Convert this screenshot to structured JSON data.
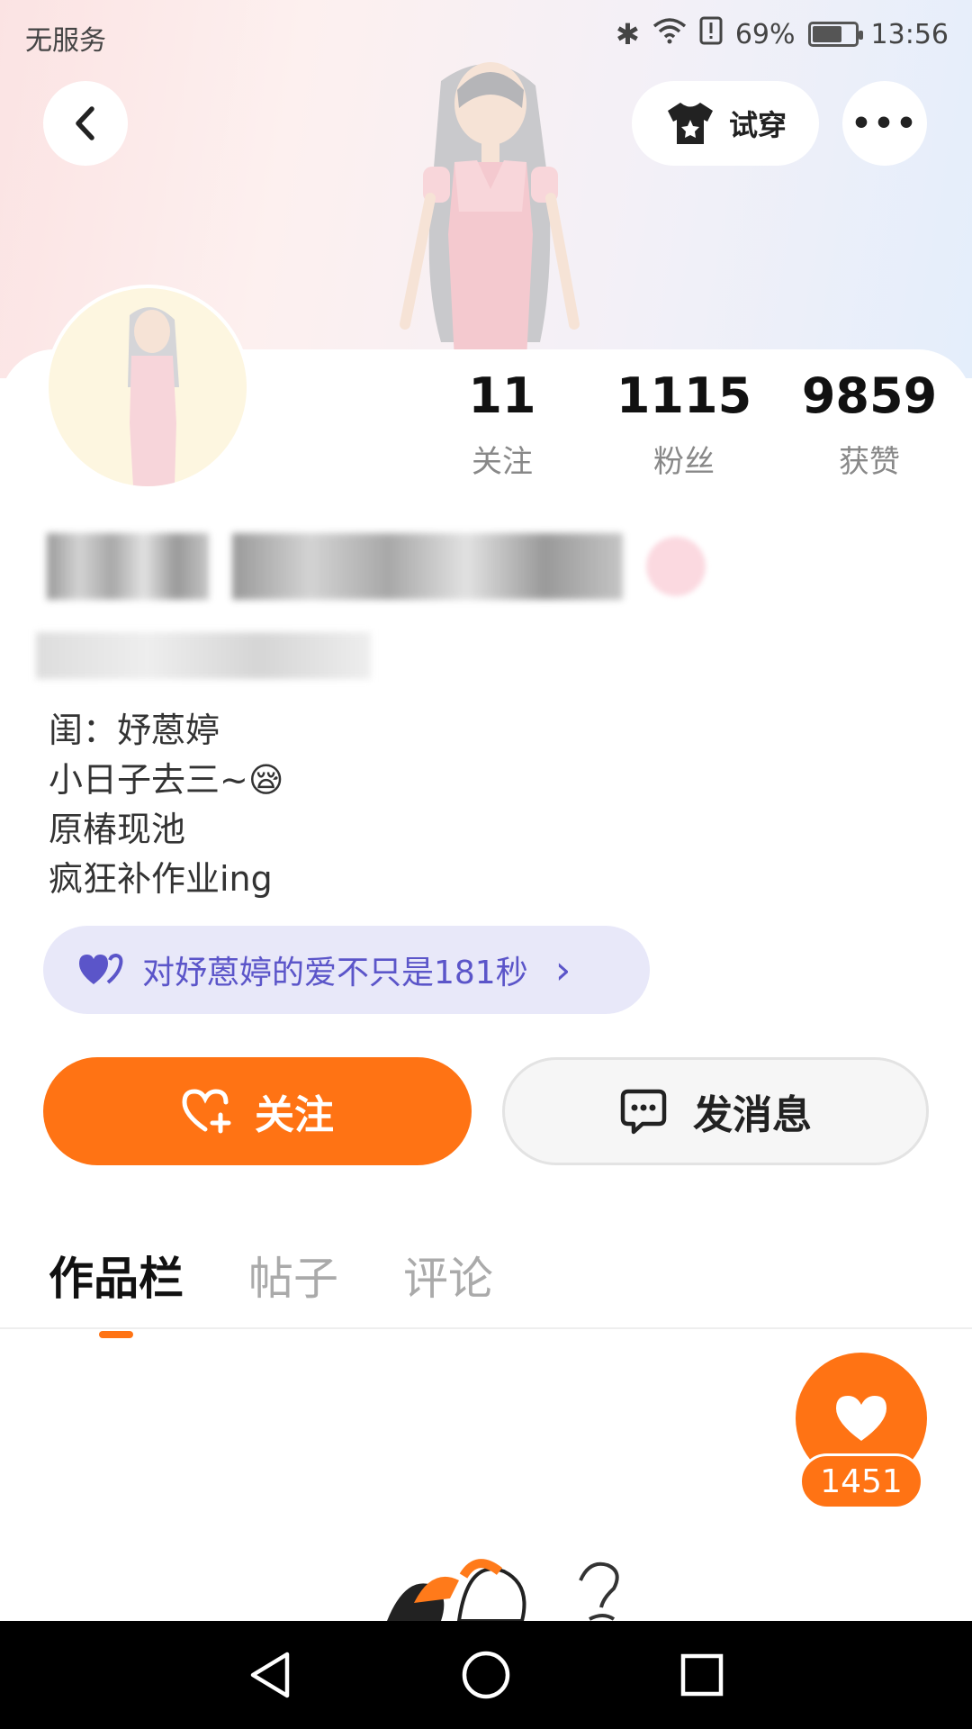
{
  "status_bar": {
    "carrier": "无服务",
    "battery_percent": "69%",
    "time": "13:56",
    "battery_level": 0.69
  },
  "header": {
    "tryon_label": "试穿"
  },
  "stats": [
    {
      "value": "11",
      "label": "关注"
    },
    {
      "value": "1115",
      "label": "粉丝"
    },
    {
      "value": "9859",
      "label": "获赞"
    }
  ],
  "bio_lines": [
    "闺：妤蒽婷",
    "小日子去三~😪",
    "原椿现池",
    "疯狂补作业ing"
  ],
  "love_pill": {
    "text": "对妤蒽婷的爱不只是181秒",
    "arrow": "›"
  },
  "actions": {
    "follow_label": "关注",
    "message_label": "发消息"
  },
  "tabs": [
    {
      "label": "作品栏",
      "active": true
    },
    {
      "label": "帖子",
      "active": false
    },
    {
      "label": "评论",
      "active": false
    }
  ],
  "like_float": {
    "count": "1451"
  },
  "colors": {
    "accent": "#ff7314",
    "pill_bg": "#e8e8f9",
    "pill_text": "#5b55c9"
  }
}
